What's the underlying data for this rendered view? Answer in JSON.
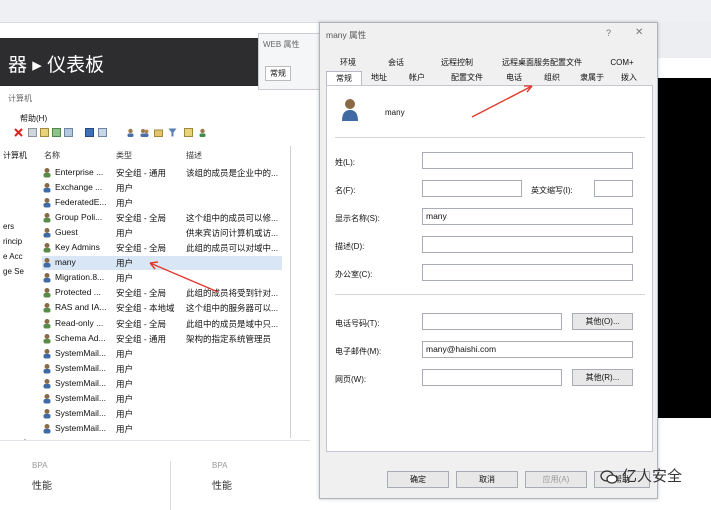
{
  "background_window": {
    "title": "器 ▸ 仪表板",
    "computer_label": "计算机",
    "menu_help": "帮助(H)",
    "columns": {
      "name": "名称",
      "type": "类型",
      "desc": "描述"
    },
    "tree_items": [
      "计算机",
      "ers",
      "rincip",
      "e Acc",
      "ge Se"
    ],
    "rows": [
      {
        "name": "Enterprise ...",
        "type": "安全组 - 通用",
        "desc": "该组的成员是企业中的..."
      },
      {
        "name": "Exchange ...",
        "type": "用户",
        "desc": ""
      },
      {
        "name": "FederatedE...",
        "type": "用户",
        "desc": ""
      },
      {
        "name": "Group Poli...",
        "type": "安全组 - 全局",
        "desc": "这个组中的成员可以修..."
      },
      {
        "name": "Guest",
        "type": "用户",
        "desc": "供来宾访问计算机或访..."
      },
      {
        "name": "Key Admins",
        "type": "安全组 - 全局",
        "desc": "此组的成员可以对域中..."
      },
      {
        "name": "many",
        "type": "用户",
        "desc": ""
      },
      {
        "name": "Migration.8...",
        "type": "用户",
        "desc": ""
      },
      {
        "name": "Protected ...",
        "type": "安全组 - 全局",
        "desc": "此组的成员将受到针对..."
      },
      {
        "name": "RAS and IA...",
        "type": "安全组 - 本地域",
        "desc": "这个组中的服务器可以..."
      },
      {
        "name": "Read-only ...",
        "type": "安全组 - 全局",
        "desc": "此组中的成员是域中只..."
      },
      {
        "name": "Schema Ad...",
        "type": "安全组 - 通用",
        "desc": "架构的指定系统管理员"
      },
      {
        "name": "SystemMail...",
        "type": "用户",
        "desc": ""
      },
      {
        "name": "SystemMail...",
        "type": "用户",
        "desc": ""
      },
      {
        "name": "SystemMail...",
        "type": "用户",
        "desc": ""
      },
      {
        "name": "SystemMail...",
        "type": "用户",
        "desc": ""
      },
      {
        "name": "SystemMail...",
        "type": "用户",
        "desc": ""
      },
      {
        "name": "SystemMail...",
        "type": "用户",
        "desc": ""
      }
    ],
    "selected_row": 6,
    "bottom_labels": [
      "性能",
      "性能"
    ],
    "bottom_small": [
      "BPA",
      "BPA"
    ]
  },
  "web_window": {
    "title": "WEB 属性",
    "tab": "常规"
  },
  "dialog": {
    "title": "many 属性",
    "help": "?",
    "close": "✕",
    "tabs_row1": [
      "环境",
      "会话",
      "远程控制",
      "远程桌面服务配置文件",
      "COM+"
    ],
    "tabs_row2": [
      "常规",
      "地址",
      "帐户",
      "配置文件",
      "电话",
      "组织",
      "隶属于",
      "拨入"
    ],
    "user_name": "many",
    "fields": {
      "last_name": {
        "label": "姓(L):",
        "value": ""
      },
      "first_name": {
        "label": "名(F):",
        "value": ""
      },
      "initials": {
        "label": "英文缩写(I):",
        "value": ""
      },
      "display_name": {
        "label": "显示名称(S):",
        "value": "many"
      },
      "description": {
        "label": "描述(D):",
        "value": ""
      },
      "office": {
        "label": "办公室(C):",
        "value": ""
      },
      "phone": {
        "label": "电话号码(T):",
        "value": ""
      },
      "email": {
        "label": "电子邮件(M):",
        "value": "many@haishi.com"
      },
      "web": {
        "label": "网页(W):",
        "value": ""
      }
    },
    "other_phone_btn": "其他(O)...",
    "other_web_btn": "其他(R)...",
    "ok": "确定",
    "cancel": "取消",
    "apply": "应用(A)",
    "help_btn": "帮助"
  },
  "watermark": "亿人安全",
  "colors": {
    "arrow": "#e23a2e",
    "selection": "#d9e6f5",
    "dark_bar": "#2d2d30"
  }
}
